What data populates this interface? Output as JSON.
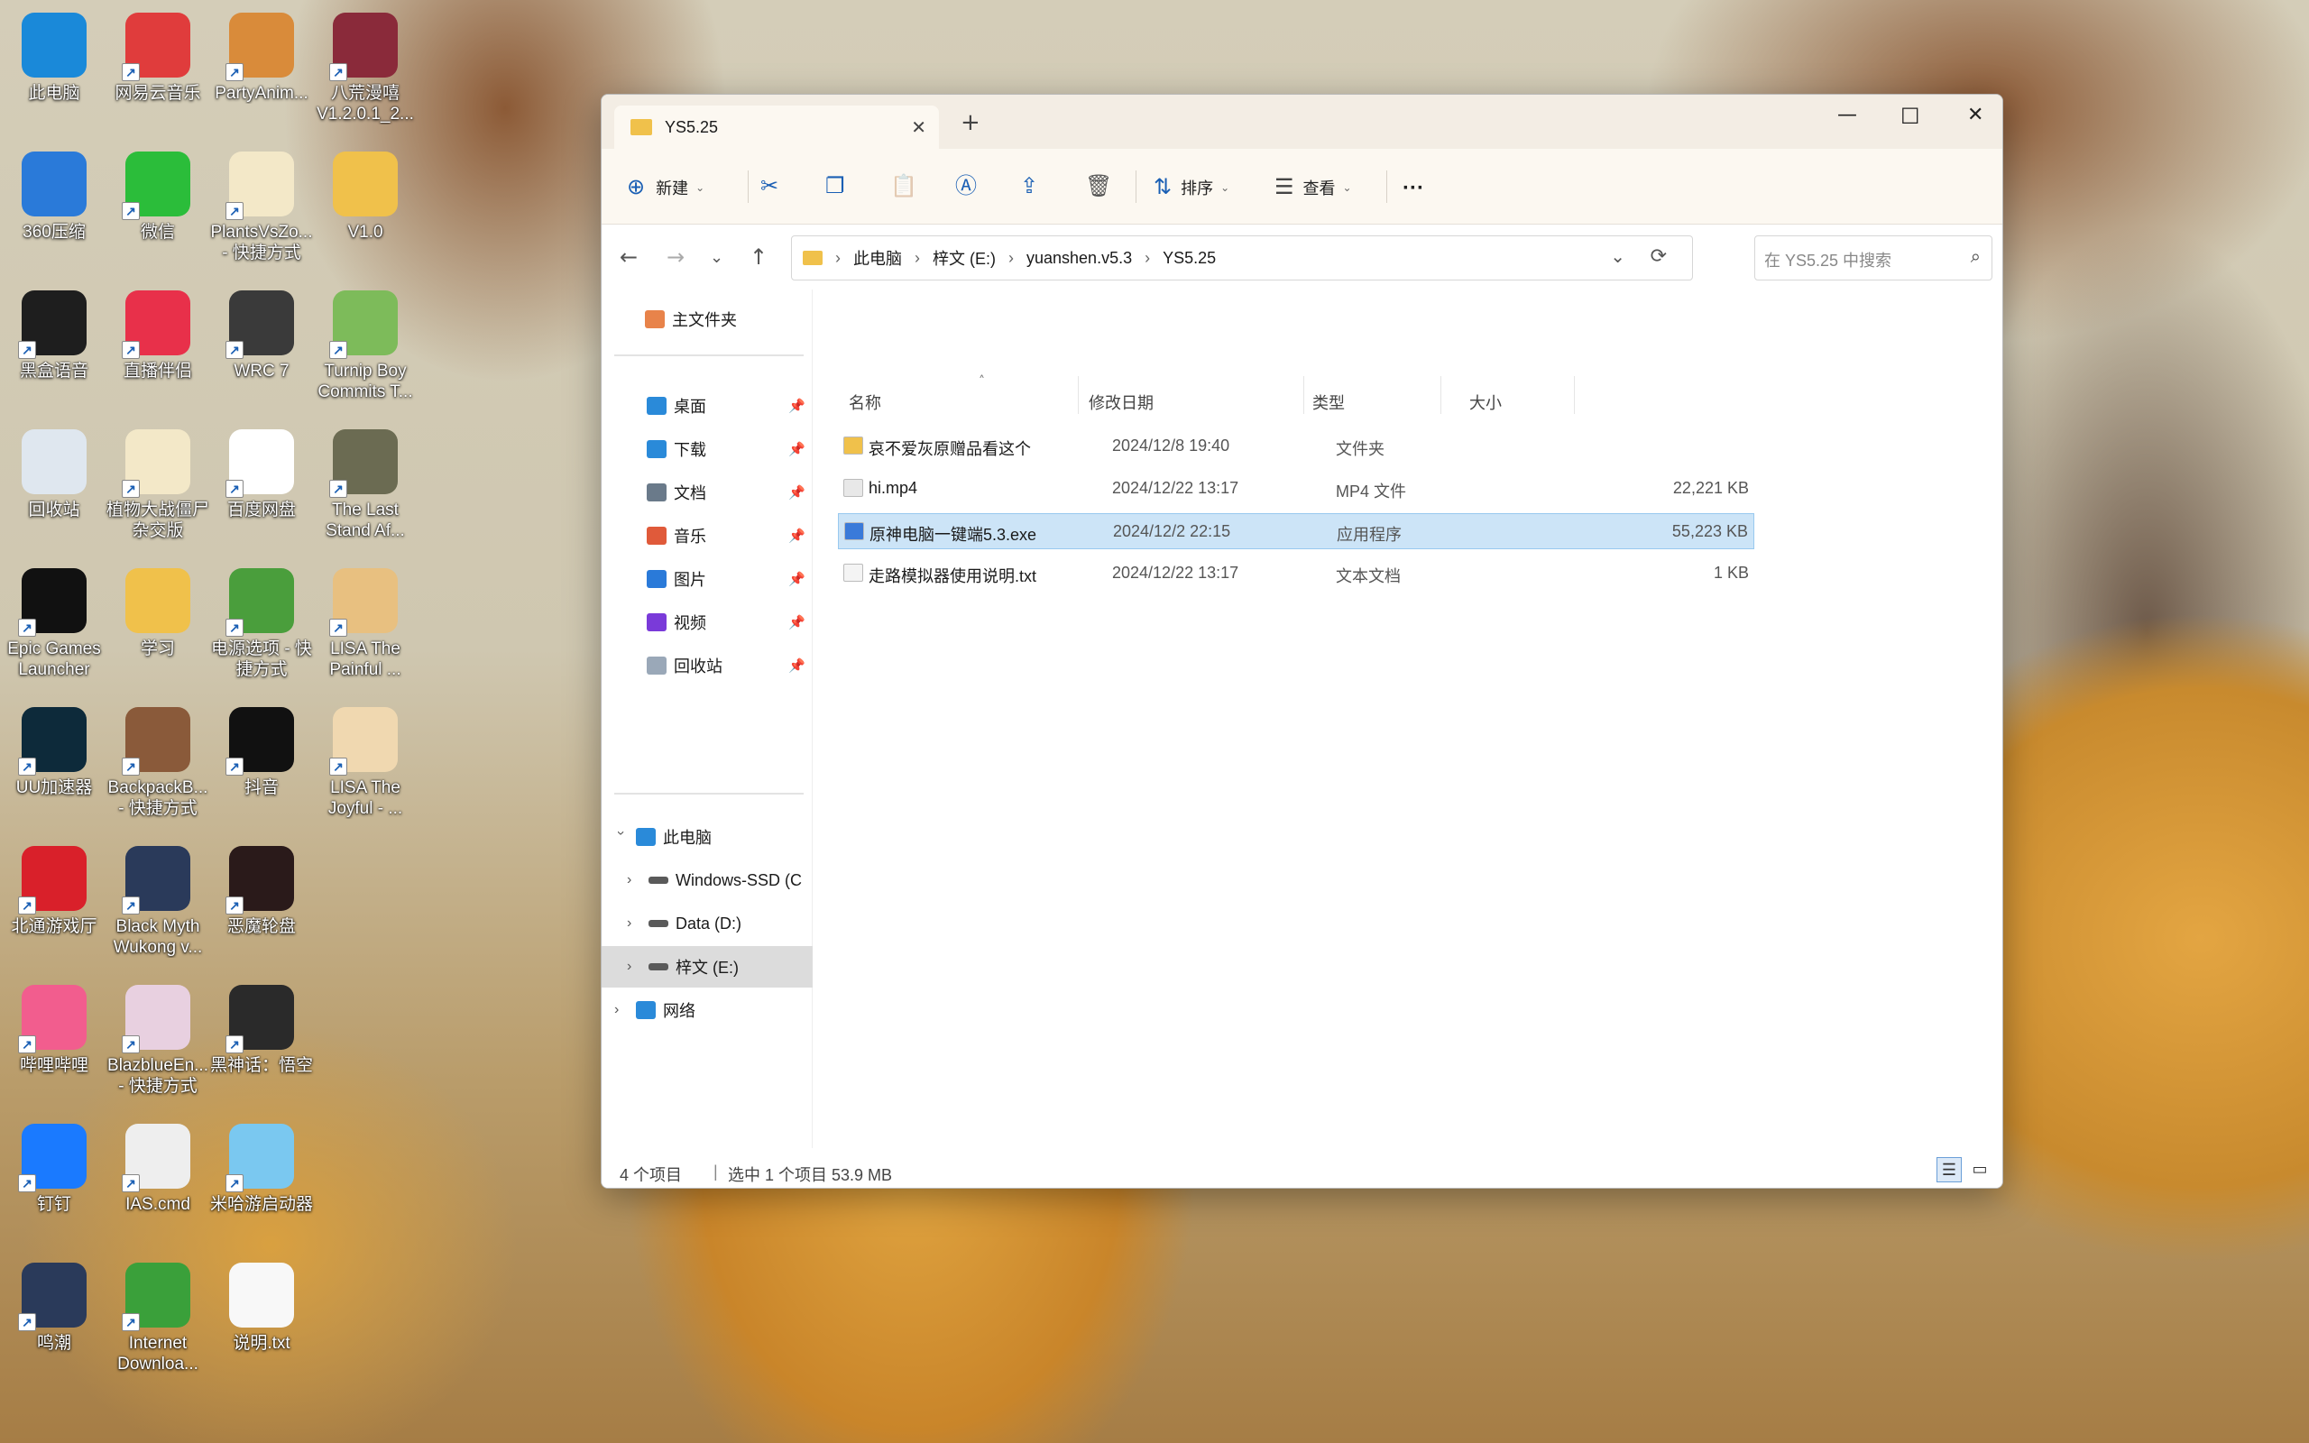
{
  "desktop": {
    "icons": [
      {
        "label1": "此电脑",
        "label2": "",
        "icon": "computer-icon",
        "color": "#1a89d9"
      },
      {
        "label1": "网易云音乐",
        "label2": "",
        "icon": "netease-music-icon",
        "color": "#e03c3c"
      },
      {
        "label1": "PartyAnim...",
        "label2": "",
        "icon": "shiba-icon",
        "color": "#d98b3a"
      },
      {
        "label1": "八荒漫嘻",
        "label2": "V1.2.0.1_2...",
        "icon": "game-icon",
        "color": "#8a2a3a"
      },
      {
        "label1": "360压缩",
        "label2": "",
        "icon": "zip-icon",
        "color": "#2a7ad9"
      },
      {
        "label1": "微信",
        "label2": "",
        "icon": "wechat-icon",
        "color": "#2bbd3a"
      },
      {
        "label1": "PlantsVsZo...",
        "label2": "- 快捷方式",
        "icon": "plant-icon",
        "color": "#f3e8c8"
      },
      {
        "label1": "V1.0",
        "label2": "",
        "icon": "folder-icon",
        "color": "#f0c14b"
      },
      {
        "label1": "黑盒语音",
        "label2": "",
        "icon": "heybox-icon",
        "color": "#1e1e1e"
      },
      {
        "label1": "直播伴侣",
        "label2": "",
        "icon": "live-icon",
        "color": "#e8304a"
      },
      {
        "label1": "WRC 7",
        "label2": "",
        "icon": "wrc-icon",
        "color": "#3a3a3a"
      },
      {
        "label1": "Turnip Boy",
        "label2": "Commits T...",
        "icon": "turnip-icon",
        "color": "#7dbb5a"
      },
      {
        "label1": "回收站",
        "label2": "",
        "icon": "recycle-bin-icon",
        "color": "#dfe7ef"
      },
      {
        "label1": "植物大战僵尸",
        "label2": "杂交版",
        "icon": "pvz-icon",
        "color": "#f3e8c8"
      },
      {
        "label1": "百度网盘",
        "label2": "",
        "icon": "baidu-disk-icon",
        "color": "#ffffff"
      },
      {
        "label1": "The Last",
        "label2": "Stand Af...",
        "icon": "laststand-icon",
        "color": "#6b6b52"
      },
      {
        "label1": "Epic Games",
        "label2": "Launcher",
        "icon": "epic-icon",
        "color": "#111111"
      },
      {
        "label1": "学习",
        "label2": "",
        "icon": "folder-icon",
        "color": "#f0c14b"
      },
      {
        "label1": "电源选项 - 快",
        "label2": "捷方式",
        "icon": "battery-icon",
        "color": "#4a9e3c"
      },
      {
        "label1": "LISA The",
        "label2": "Painful ...",
        "icon": "lisa-icon",
        "color": "#e8c080"
      },
      {
        "label1": "UU加速器",
        "label2": "",
        "icon": "uu-icon",
        "color": "#0d2a3a"
      },
      {
        "label1": "BackpackB...",
        "label2": "- 快捷方式",
        "icon": "backpack-icon",
        "color": "#8a5a3a"
      },
      {
        "label1": "抖音",
        "label2": "",
        "icon": "douyin-icon",
        "color": "#111111"
      },
      {
        "label1": "LISA The",
        "label2": "Joyful - ...",
        "icon": "lisa-joyful-icon",
        "color": "#f0d8b0"
      },
      {
        "label1": "北通游戏厅",
        "label2": "",
        "icon": "betop-icon",
        "color": "#d9202a"
      },
      {
        "label1": "Black Myth",
        "label2": "Wukong v...",
        "icon": "trainer-icon",
        "color": "#2a3a5a"
      },
      {
        "label1": "恶魔轮盘",
        "label2": "",
        "icon": "roulette-icon",
        "color": "#2a1a1a"
      },
      {
        "label1": "",
        "label2": "",
        "icon": "empty",
        "color": "transparent"
      },
      {
        "label1": "哔哩哔哩",
        "label2": "",
        "icon": "bilibili-icon",
        "color": "#f25d8e"
      },
      {
        "label1": "BlazblueEn...",
        "label2": "- 快捷方式",
        "icon": "blazblue-icon",
        "color": "#e8d0e0"
      },
      {
        "label1": "黑神话：悟空",
        "label2": "",
        "icon": "wukong-icon",
        "color": "#2a2a2a"
      },
      {
        "label1": "",
        "label2": "",
        "icon": "empty",
        "color": "transparent"
      },
      {
        "label1": "钉钉",
        "label2": "",
        "icon": "dingtalk-icon",
        "color": "#1a7aff"
      },
      {
        "label1": "IAS.cmd",
        "label2": "",
        "icon": "gear-file-icon",
        "color": "#eeeeee"
      },
      {
        "label1": "米哈游启动器",
        "label2": "",
        "icon": "mihoyo-icon",
        "color": "#7ac8f0"
      },
      {
        "label1": "",
        "label2": "",
        "icon": "empty",
        "color": "transparent"
      },
      {
        "label1": "鸣潮",
        "label2": "",
        "icon": "wuthering-icon",
        "color": "#2a3a5a"
      },
      {
        "label1": "Internet",
        "label2": "Downloa...",
        "icon": "idm-icon",
        "color": "#3aa03a"
      },
      {
        "label1": "说明.txt",
        "label2": "",
        "icon": "text-file-icon",
        "color": "#f8f8f8"
      }
    ]
  },
  "explorer": {
    "tab_title": "YS5.25",
    "toolbar": {
      "new_label": "新建",
      "sort_label": "排序",
      "view_label": "查看",
      "more": "···"
    },
    "address": {
      "crumbs": [
        "此电脑",
        "梓文 (E:)",
        "yuanshen.v5.3",
        "YS5.25"
      ],
      "sep": "›"
    },
    "search_placeholder": "在 YS5.25 中搜索",
    "nav": {
      "home": "主文件夹",
      "quick": [
        {
          "label": "桌面",
          "color": "#2a8ad9"
        },
        {
          "label": "下载",
          "color": "#2a8ad9"
        },
        {
          "label": "文档",
          "color": "#6a7a8a"
        },
        {
          "label": "音乐",
          "color": "#e05a3a"
        },
        {
          "label": "图片",
          "color": "#2a7ad9"
        },
        {
          "label": "视频",
          "color": "#7a3ad9"
        },
        {
          "label": "回收站",
          "color": "#9aa8b8"
        }
      ],
      "pc": "此电脑",
      "drives": [
        {
          "label": "Windows-SSD (C"
        },
        {
          "label": "Data (D:)"
        },
        {
          "label": "梓文 (E:)"
        }
      ],
      "network": "网络"
    },
    "columns": {
      "name": "名称",
      "date": "修改日期",
      "type": "类型",
      "size": "大小"
    },
    "files": [
      {
        "name": "哀不爱灰原赠品看这个",
        "date": "2024/12/8 19:40",
        "type": "文件夹",
        "size": "",
        "color": "#f0c14b"
      },
      {
        "name": "hi.mp4",
        "date": "2024/12/22 13:17",
        "type": "MP4 文件",
        "size": "22,221 KB",
        "color": "#e8e8e8"
      },
      {
        "name": "原神电脑一键端5.3.exe",
        "date": "2024/12/2 22:15",
        "type": "应用程序",
        "size": "55,223 KB",
        "color": "#3a7ad9"
      },
      {
        "name": "走路模拟器使用说明.txt",
        "date": "2024/12/22 13:17",
        "type": "文本文档",
        "size": "1 KB",
        "color": "#f4f4f4"
      }
    ],
    "status": {
      "count": "4 个项目",
      "selected": "选中 1 个项目  53.9 MB"
    }
  }
}
